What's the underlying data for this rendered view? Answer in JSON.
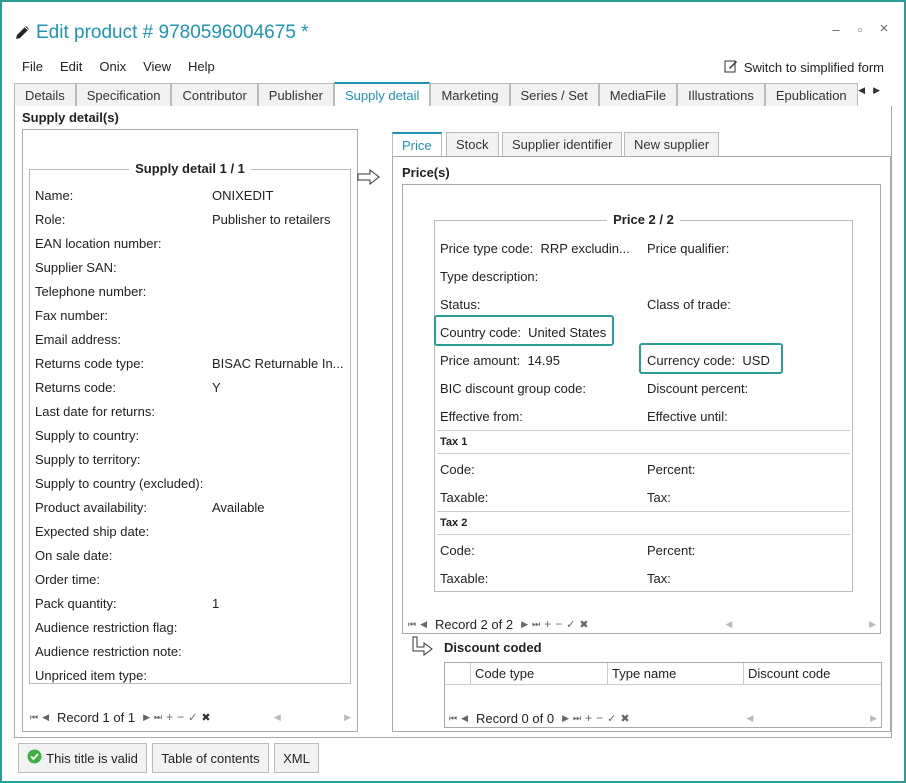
{
  "window": {
    "title": "Edit product # 9780596004675 *",
    "minimize": "–",
    "maximize": "▫",
    "close": "×"
  },
  "menu": [
    "File",
    "Edit",
    "Onix",
    "View",
    "Help"
  ],
  "switch_simplified": "Switch to simplified form",
  "tabs": [
    "Details",
    "Specification",
    "Contributor",
    "Publisher",
    "Supply detail",
    "Marketing",
    "Series / Set",
    "MediaFile",
    "Illustrations",
    "Epublication"
  ],
  "active_tab": "Supply detail",
  "supply": {
    "section_title": "Supply detail(s)",
    "legend": "Supply detail 1 / 1",
    "fields": [
      {
        "label": "Name:",
        "value": "ONIXEDIT"
      },
      {
        "label": "Role:",
        "value": "Publisher to retailers"
      },
      {
        "label": "EAN location number:",
        "value": ""
      },
      {
        "label": "Supplier SAN:",
        "value": ""
      },
      {
        "label": "Telephone number:",
        "value": ""
      },
      {
        "label": "Fax number:",
        "value": ""
      },
      {
        "label": "Email address:",
        "value": ""
      },
      {
        "label": "Returns code type:",
        "value": "BISAC Returnable In..."
      },
      {
        "label": "Returns code:",
        "value": "Y"
      },
      {
        "label": "Last date for returns:",
        "value": ""
      },
      {
        "label": "Supply to country:",
        "value": ""
      },
      {
        "label": "Supply to territory:",
        "value": ""
      },
      {
        "label": "Supply to country (excluded):",
        "value": ""
      },
      {
        "label": "Product availability:",
        "value": "Available"
      },
      {
        "label": "Expected ship date:",
        "value": ""
      },
      {
        "label": "On sale date:",
        "value": ""
      },
      {
        "label": "Order time:",
        "value": ""
      },
      {
        "label": "Pack quantity:",
        "value": "1"
      },
      {
        "label": "Audience restriction flag:",
        "value": ""
      },
      {
        "label": "Audience restriction note:",
        "value": ""
      },
      {
        "label": "Unpriced item type:",
        "value": ""
      }
    ],
    "record_text": "Record 1 of 1"
  },
  "subtabs": [
    "Price",
    "Stock",
    "Supplier identifier",
    "New supplier"
  ],
  "price": {
    "section_title": "Price(s)",
    "legend": "Price 2 / 2",
    "price_type": {
      "label": "Price type code:",
      "value": "RRP excludin..."
    },
    "price_qualifier": {
      "label": "Price qualifier:",
      "value": ""
    },
    "type_description": {
      "label": "Type description:",
      "value": ""
    },
    "status": {
      "label": "Status:",
      "value": ""
    },
    "class_of_trade": {
      "label": "Class of trade:",
      "value": ""
    },
    "country_code": {
      "label": "Country code:",
      "value": "United States"
    },
    "price_amount": {
      "label": "Price amount:",
      "value": "14.95"
    },
    "currency_code": {
      "label": "Currency code:",
      "value": "USD"
    },
    "bic_discount": {
      "label": "BIC discount group code:",
      "value": ""
    },
    "discount_percent": {
      "label": "Discount percent:",
      "value": ""
    },
    "effective_from": {
      "label": "Effective from:",
      "value": ""
    },
    "effective_until": {
      "label": "Effective until:",
      "value": ""
    },
    "tax1": {
      "title": "Tax 1",
      "code": "Code:",
      "percent": "Percent:",
      "taxable": "Taxable:",
      "tax": "Tax:"
    },
    "tax2": {
      "title": "Tax 2",
      "code": "Code:",
      "percent": "Percent:",
      "taxable": "Taxable:",
      "tax": "Tax:"
    },
    "record_text": "Record 2 of 2"
  },
  "discount": {
    "title": "Discount coded",
    "columns": [
      "Code type",
      "Type name",
      "Discount code"
    ],
    "record_text": "Record 0 of 0"
  },
  "bottom_buttons": {
    "valid": "This title is valid",
    "toc": "Table of contents",
    "xml": "XML"
  },
  "colors": {
    "accent": "#1e94b4",
    "highlight_border": "#2a9d96",
    "valid_green": "#3cb043"
  }
}
